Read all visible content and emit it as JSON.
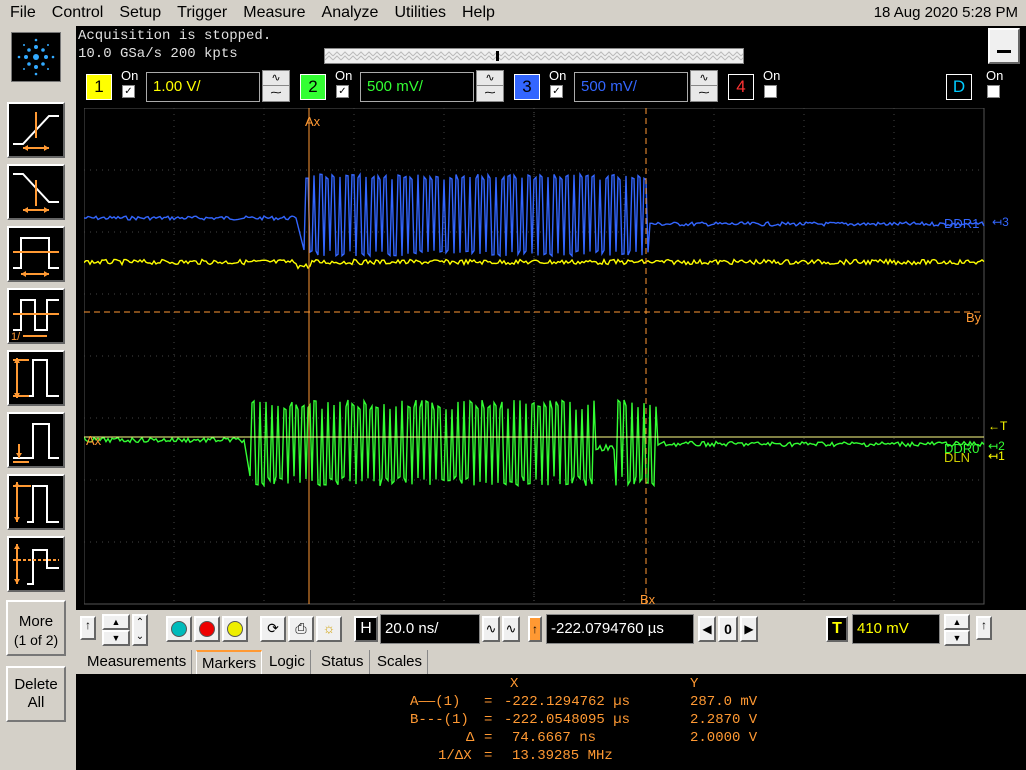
{
  "menu": [
    "File",
    "Control",
    "Setup",
    "Trigger",
    "Measure",
    "Analyze",
    "Utilities",
    "Help"
  ],
  "datetime": "18 Aug 2020  5:28 PM",
  "status": {
    "line1": "Acquisition is stopped.",
    "line2": "10.0 GSa/s   200 kpts",
    "timeline_marker": "i"
  },
  "channels": [
    {
      "num": "1",
      "on_label": "On",
      "checked": true,
      "scale": "1.00 V/",
      "color": "#ffff00"
    },
    {
      "num": "2",
      "on_label": "On",
      "checked": true,
      "scale": "500 mV/",
      "color": "#33ff33"
    },
    {
      "num": "3",
      "on_label": "On",
      "checked": true,
      "scale": "500 mV/",
      "color": "#3366ff"
    },
    {
      "num": "4",
      "on_label": "On",
      "checked": false,
      "scale": "",
      "color": "#ff3333"
    },
    {
      "num": "D",
      "on_label": "On",
      "checked": false,
      "scale": "",
      "color": "#00ccff"
    }
  ],
  "waveform": {
    "labels": {
      "ax_top": "Ax",
      "bx_bottom": "Bx",
      "by_right": "By",
      "ax_left": "Ax",
      "ddr1": "DDR1",
      "ddr0": "DDR0",
      "ch3_marker": "3",
      "ch2_marker": "2",
      "ch1_marker": "1",
      "trig_marker": "T",
      "ddr1_underlay": "DLN"
    }
  },
  "left_toolbar": {
    "more_label": "More",
    "more_page": "(1 of 2)",
    "delete_label_1": "Delete",
    "delete_label_2": "All",
    "trigger_buttons": [
      "rising-edge",
      "falling-edge",
      "pulse-width",
      "period",
      "setup-hold",
      "runt",
      "transition",
      "window"
    ]
  },
  "controls": {
    "horiz_label": "H",
    "timebase": "20.0 ns/",
    "delay": "-222.0794760 µs",
    "ref_value": "0",
    "trigger_label": "T",
    "trigger_level": "410 mV"
  },
  "tabs": [
    "Measurements",
    "Markers",
    "Logic",
    "Status",
    "Scales"
  ],
  "active_tab": "Markers",
  "markers": {
    "col_x": "X",
    "col_y": "Y",
    "rows": [
      {
        "label": "A——(1)",
        "eq": "=",
        "x": "-222.1294762 µs",
        "y": "287.0 mV"
      },
      {
        "label": "B---(1)",
        "eq": "=",
        "x": "-222.0548095 µs",
        "y": "2.2870 V"
      },
      {
        "label": "Δ",
        "eq": "=",
        "x": "74.6667 ns",
        "y": "2.0000 V"
      },
      {
        "label": "1/ΔX",
        "eq": "=",
        "x": "13.39285 MHz",
        "y": ""
      }
    ]
  }
}
